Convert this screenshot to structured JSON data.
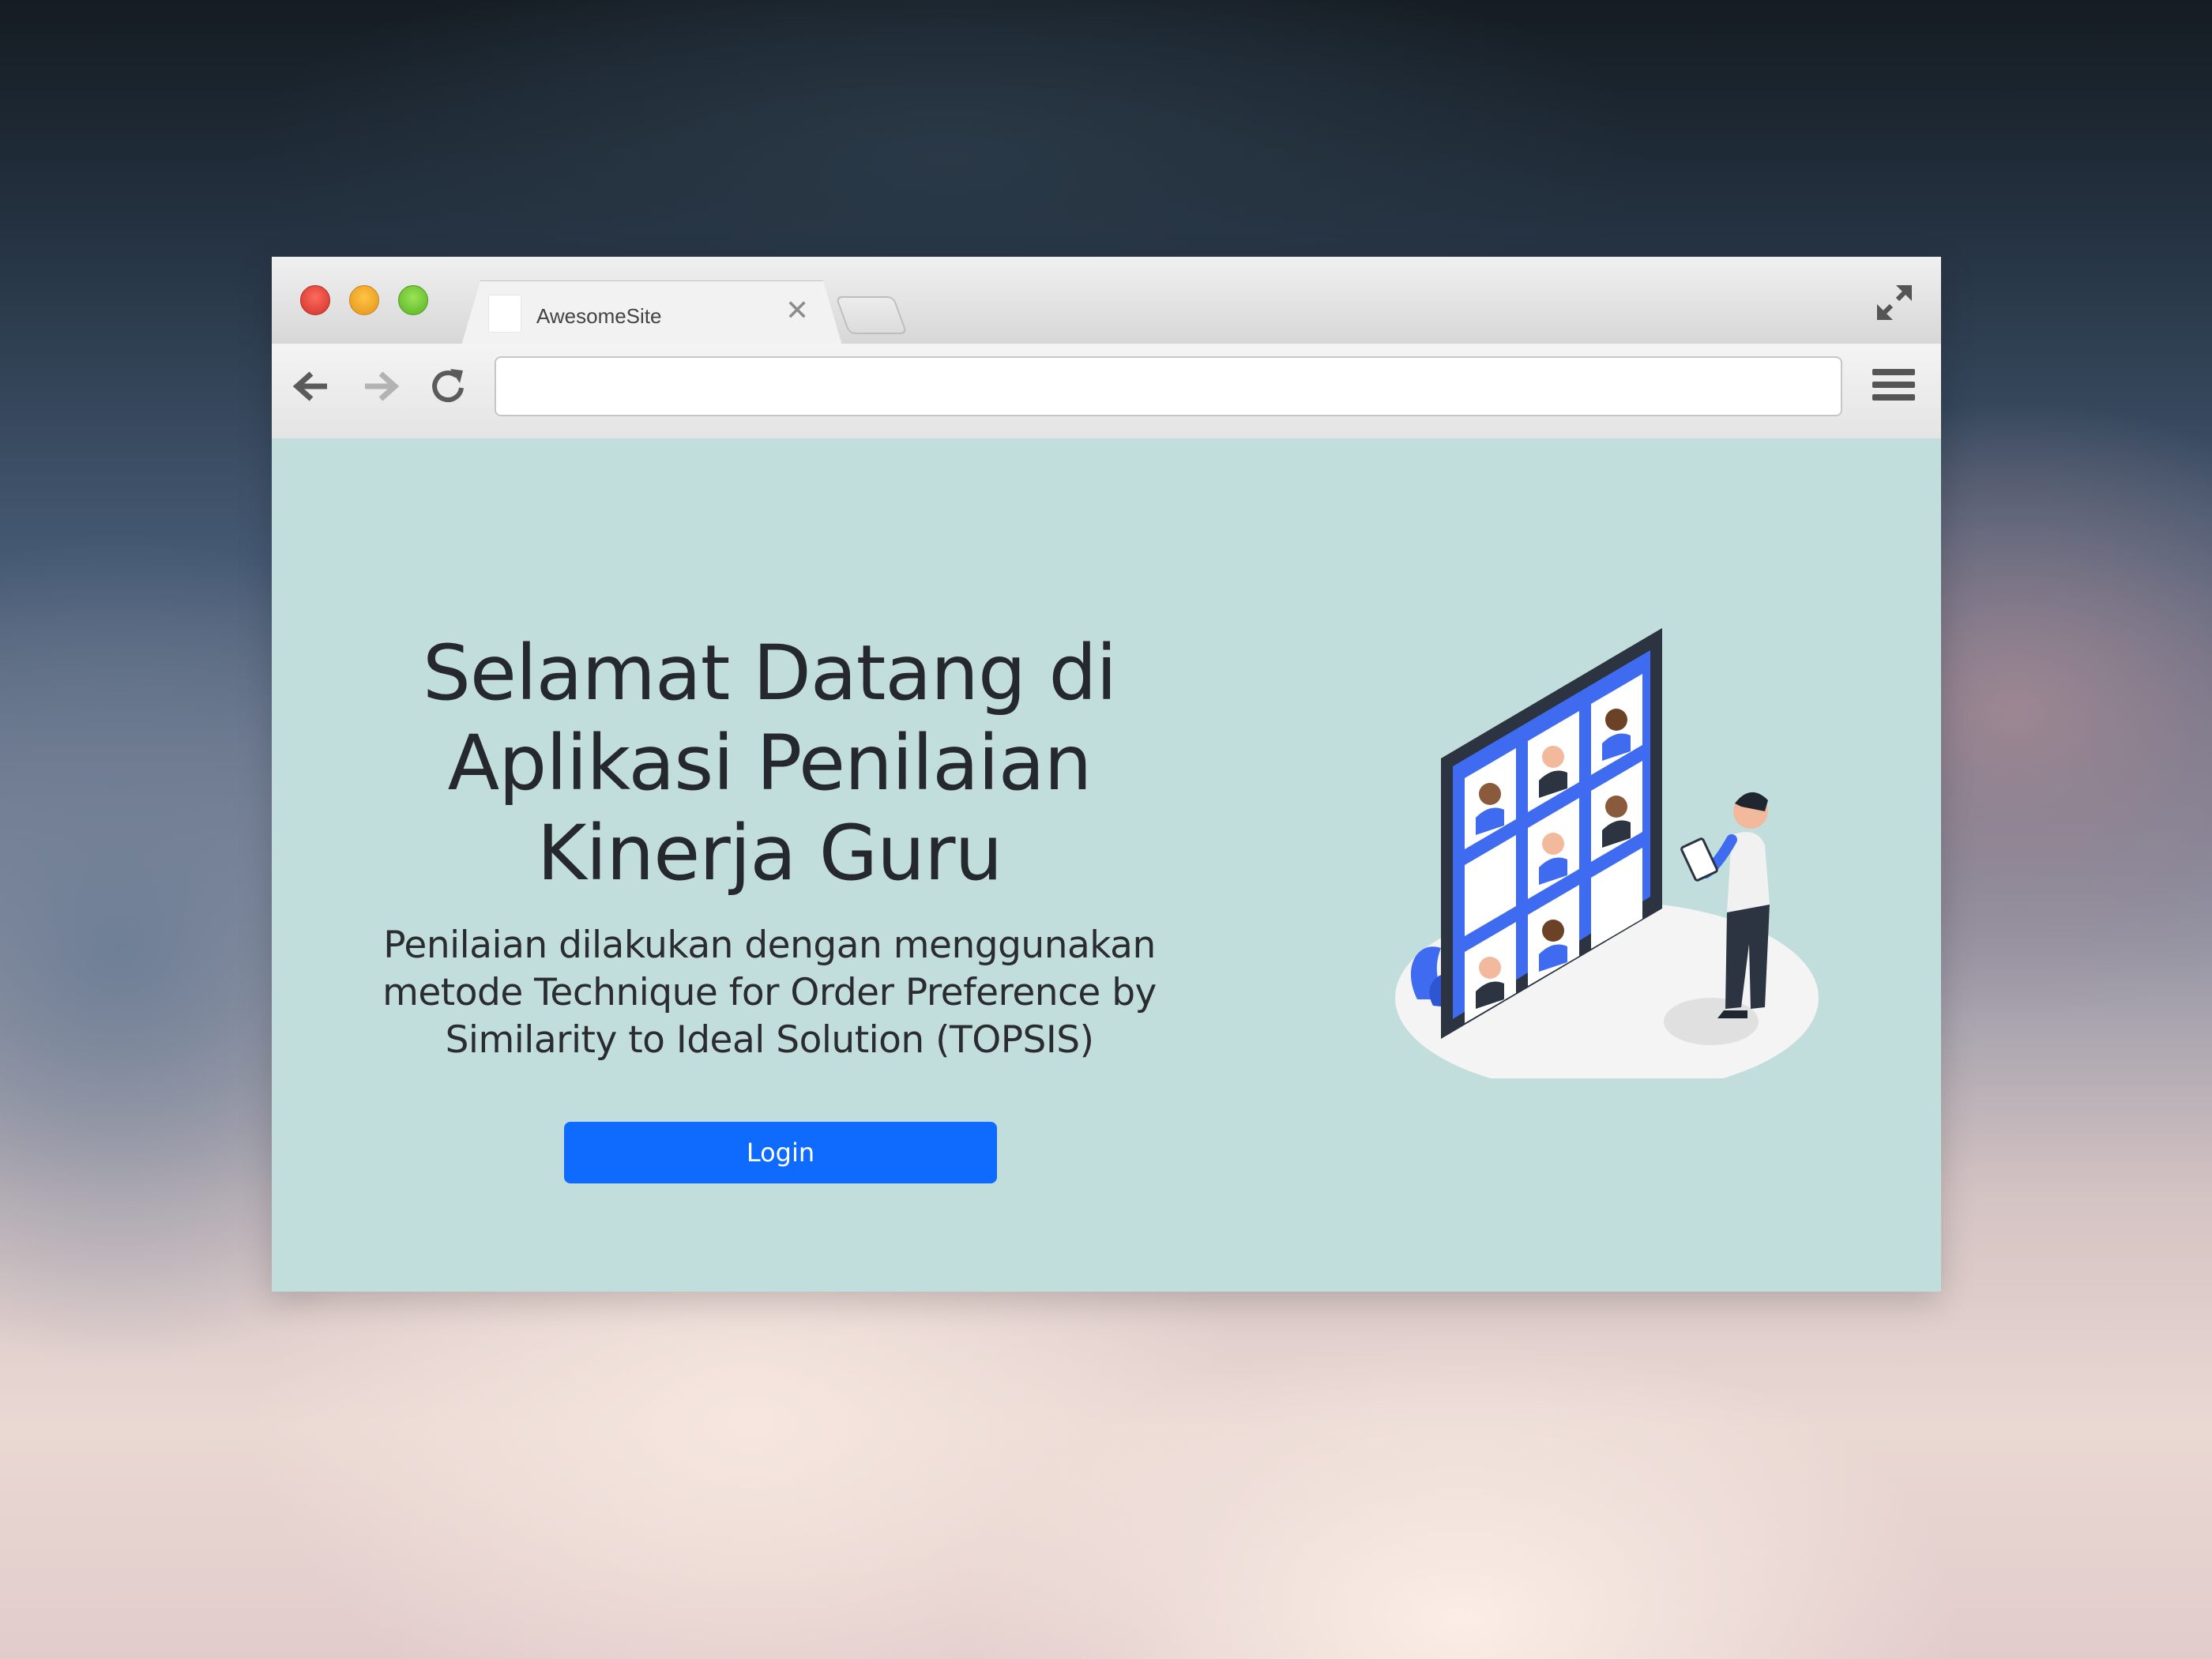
{
  "browser": {
    "tab": {
      "title": "AwesomeSite",
      "close_symbol": "✕"
    },
    "address_bar": {
      "value": "",
      "placeholder": ""
    },
    "icons": {
      "back": "arrow-left-icon",
      "forward": "arrow-right-icon",
      "reload": "reload-icon",
      "menu": "hamburger-menu-icon",
      "fullscreen": "expand-icon"
    }
  },
  "hero": {
    "title": "Selamat Datang di Aplikasi Penilaian Kinerja Guru",
    "subtitle": "Penilaian dilakukan dengan menggunakan metode Technique for Order Preference by Similarity to Ideal Solution (TOPSIS)",
    "login_label": "Login"
  },
  "colors": {
    "page_background": "#c2dedc",
    "button": "#0f6bfd",
    "text": "#25282c",
    "illustration_accent": "#3f6bf0"
  }
}
